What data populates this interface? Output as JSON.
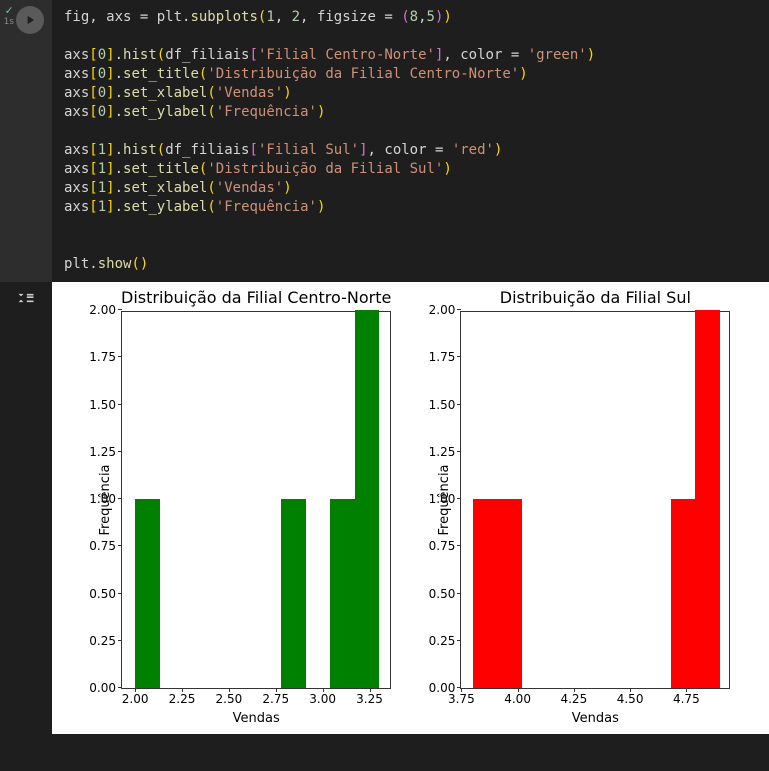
{
  "cell": {
    "status_time": "1s",
    "code": {
      "l1_a": "fig, axs = plt.",
      "l1_b": "subplots",
      "l1_c": "(",
      "l1_d": "1",
      "l1_e": ", ",
      "l1_f": "2",
      "l1_g": ", figsize = ",
      "l1_h": "(",
      "l1_i": "8",
      "l1_j": ",",
      "l1_k": "5",
      "l1_l": ")",
      "l1_m": ")",
      "l3_a": "axs",
      "l3_b": "[",
      "l3_c": "0",
      "l3_d": "]",
      "l3_e": ".",
      "l3_f": "hist",
      "l3_g": "(",
      "l3_h": "df_filiais",
      "l3_i": "[",
      "l3_j": "'Filial Centro-Norte'",
      "l3_k": "]",
      "l3_l": ", color = ",
      "l3_m": "'green'",
      "l3_n": ")",
      "l4_a": "axs",
      "l4_b": "[",
      "l4_c": "0",
      "l4_d": "]",
      "l4_e": ".",
      "l4_f": "set_title",
      "l4_g": "(",
      "l4_h": "'Distribuição da Filial Centro-Norte'",
      "l4_i": ")",
      "l5_a": "axs",
      "l5_b": "[",
      "l5_c": "0",
      "l5_d": "]",
      "l5_e": ".",
      "l5_f": "set_xlabel",
      "l5_g": "(",
      "l5_h": "'Vendas'",
      "l5_i": ")",
      "l6_a": "axs",
      "l6_b": "[",
      "l6_c": "0",
      "l6_d": "]",
      "l6_e": ".",
      "l6_f": "set_ylabel",
      "l6_g": "(",
      "l6_h": "'Frequência'",
      "l6_i": ")",
      "l8_a": "axs",
      "l8_b": "[",
      "l8_c": "1",
      "l8_d": "]",
      "l8_e": ".",
      "l8_f": "hist",
      "l8_g": "(",
      "l8_h": "df_filiais",
      "l8_i": "[",
      "l8_j": "'Filial Sul'",
      "l8_k": "]",
      "l8_l": ", color = ",
      "l8_m": "'red'",
      "l8_n": ")",
      "l9_a": "axs",
      "l9_b": "[",
      "l9_c": "1",
      "l9_d": "]",
      "l9_e": ".",
      "l9_f": "set_title",
      "l9_g": "(",
      "l9_h": "'Distribuição da Filial Sul'",
      "l9_i": ")",
      "l10_a": "axs",
      "l10_b": "[",
      "l10_c": "1",
      "l10_d": "]",
      "l10_e": ".",
      "l10_f": "set_xlabel",
      "l10_g": "(",
      "l10_h": "'Vendas'",
      "l10_i": ")",
      "l11_a": "axs",
      "l11_b": "[",
      "l11_c": "1",
      "l11_d": "]",
      "l11_e": ".",
      "l11_f": "set_ylabel",
      "l11_g": "(",
      "l11_h": "'Frequência'",
      "l11_i": ")",
      "l14_a": "plt.",
      "l14_b": "show",
      "l14_c": "(",
      "l14_d": ")"
    }
  },
  "chart_data": [
    {
      "type": "bar",
      "title": "Distribuição da Filial Centro-Norte",
      "xlabel": "Vendas",
      "ylabel": "Frequência",
      "xlim": [
        1.93,
        3.37
      ],
      "ylim": [
        0,
        2
      ],
      "xticks": [
        "2.00",
        "2.25",
        "2.50",
        "2.75",
        "3.00",
        "3.25"
      ],
      "xtick_vals": [
        2.0,
        2.25,
        2.5,
        2.75,
        3.0,
        3.25
      ],
      "yticks": [
        "0.00",
        "0.25",
        "0.50",
        "0.75",
        "1.00",
        "1.25",
        "1.50",
        "1.75",
        "2.00"
      ],
      "ytick_vals": [
        0,
        0.25,
        0.5,
        0.75,
        1.0,
        1.25,
        1.5,
        1.75,
        2.0
      ],
      "color": "#008000",
      "bars": [
        {
          "x0": 2.0,
          "x1": 2.13,
          "y": 1
        },
        {
          "x0": 2.78,
          "x1": 2.91,
          "y": 1
        },
        {
          "x0": 3.04,
          "x1": 3.17,
          "y": 1
        },
        {
          "x0": 3.17,
          "x1": 3.3,
          "y": 2
        }
      ]
    },
    {
      "type": "bar",
      "title": "Distribuição da Filial Sul",
      "xlabel": "Vendas",
      "ylabel": "Frequência",
      "xlim": [
        3.75,
        4.95
      ],
      "ylim": [
        0,
        2
      ],
      "xticks": [
        "3.75",
        "4.00",
        "4.25",
        "4.50",
        "4.75"
      ],
      "xtick_vals": [
        3.75,
        4.0,
        4.25,
        4.5,
        4.75
      ],
      "yticks": [
        "0.00",
        "0.25",
        "0.50",
        "0.75",
        "1.00",
        "1.25",
        "1.50",
        "1.75",
        "2.00"
      ],
      "ytick_vals": [
        0,
        0.25,
        0.5,
        0.75,
        1.0,
        1.25,
        1.5,
        1.75,
        2.0
      ],
      "color": "#ff0000",
      "bars": [
        {
          "x0": 3.8,
          "x1": 4.02,
          "y": 1
        },
        {
          "x0": 4.68,
          "x1": 4.79,
          "y": 1
        },
        {
          "x0": 4.79,
          "x1": 4.9,
          "y": 2
        }
      ]
    }
  ]
}
